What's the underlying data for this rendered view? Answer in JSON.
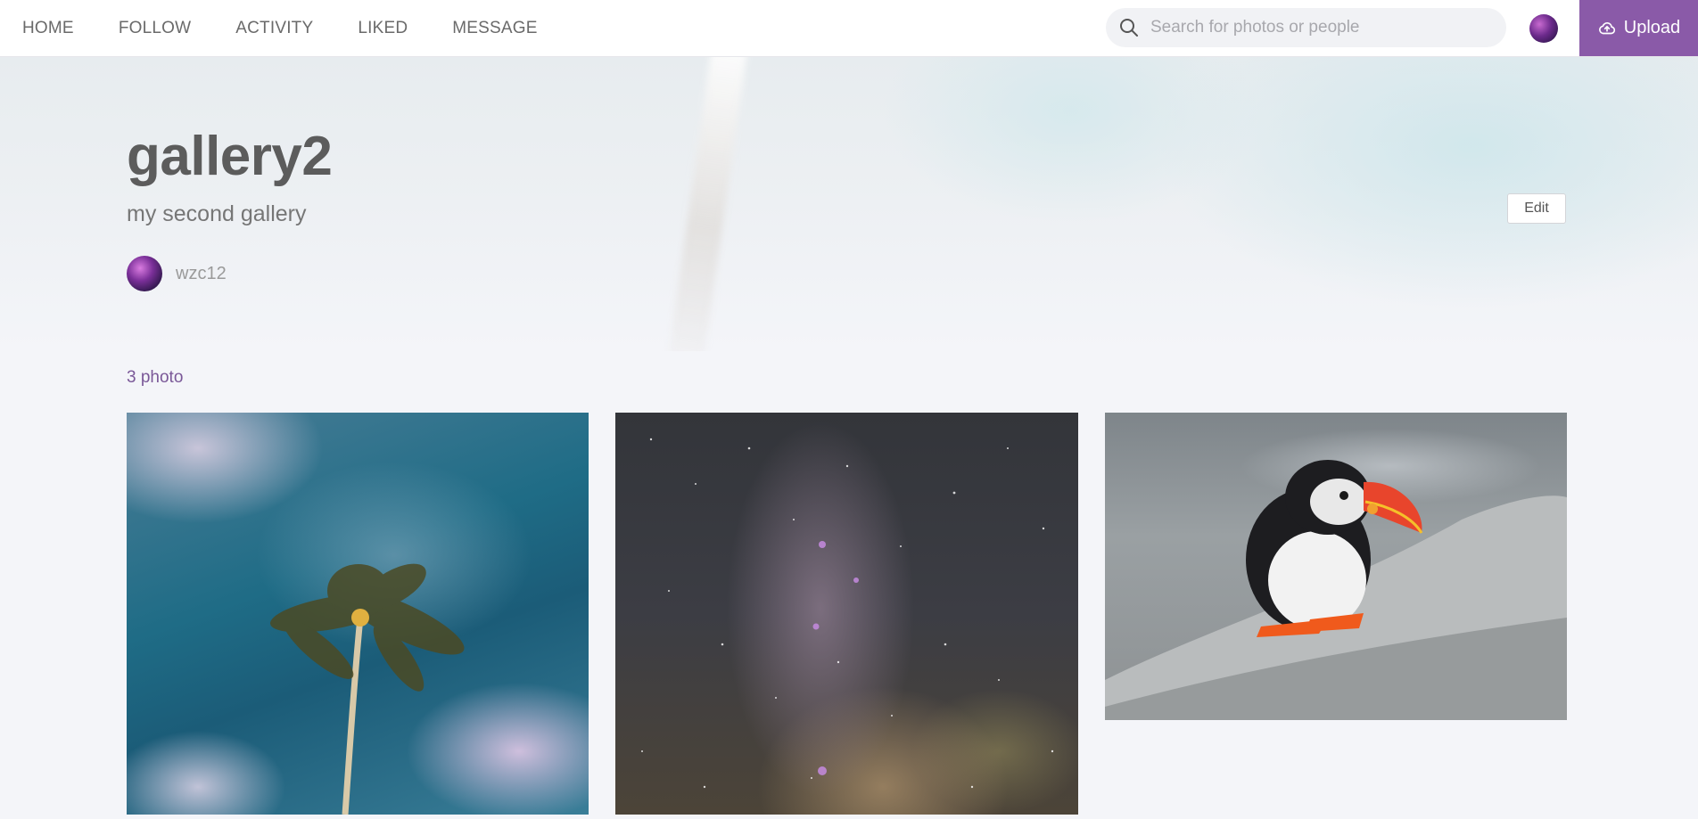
{
  "nav": {
    "items": [
      {
        "label": "HOME"
      },
      {
        "label": "FOLLOW"
      },
      {
        "label": "ACTIVITY"
      },
      {
        "label": "LIKED"
      },
      {
        "label": "MESSAGE"
      }
    ]
  },
  "search": {
    "placeholder": "Search for photos or people",
    "value": ""
  },
  "upload": {
    "label": "Upload"
  },
  "gallery": {
    "title": "gallery2",
    "description": "my second gallery",
    "owner": "wzc12",
    "edit_label": "Edit",
    "count_label": "3 photo"
  },
  "colors": {
    "accent": "#8a5aa8",
    "count_text": "#7a5898"
  }
}
